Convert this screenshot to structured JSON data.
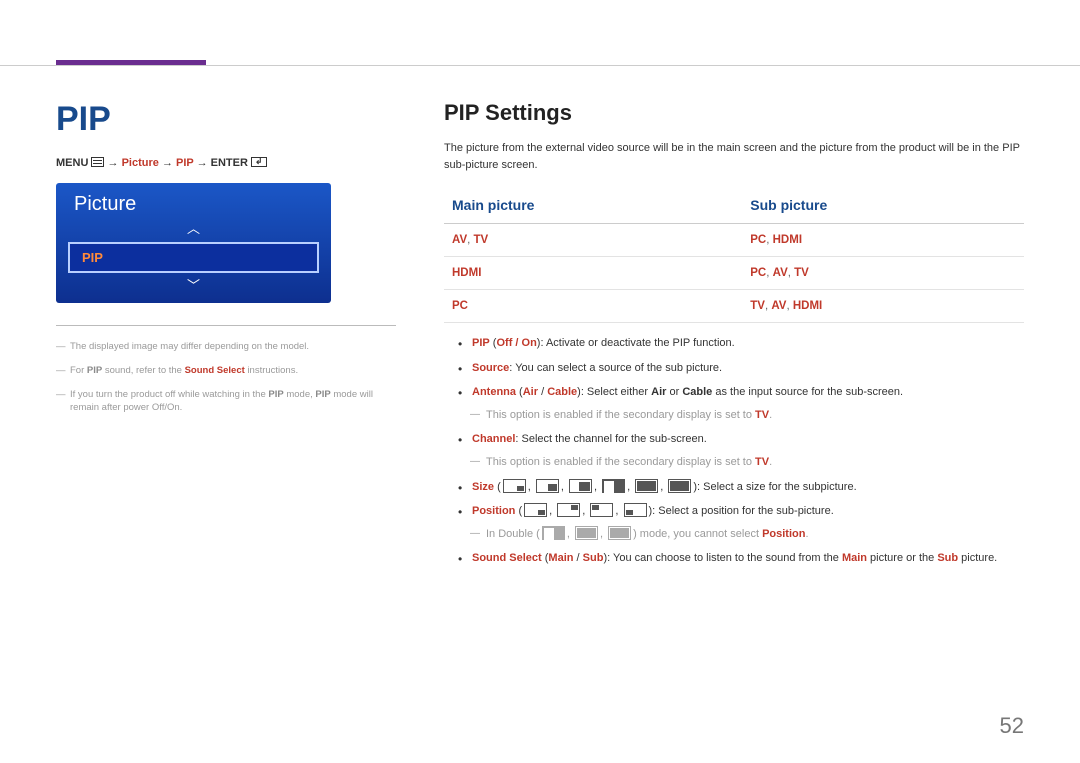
{
  "page_number": "52",
  "left": {
    "title": "PIP",
    "breadcrumb": {
      "menu": "MENU",
      "arrow": " → ",
      "picture": "Picture",
      "pip": "PIP",
      "enter": "ENTER"
    },
    "osd": {
      "title": "Picture",
      "selected": "PIP"
    },
    "notes": {
      "n1": "The displayed image may differ depending on the model.",
      "n2_a": "For ",
      "n2_pip": "PIP",
      "n2_b": " sound, refer to the ",
      "n2_ss": "Sound Select",
      "n2_c": " instructions.",
      "n3_a": "If you turn the product off while watching in the ",
      "n3_pip1": "PIP",
      "n3_b": " mode, ",
      "n3_pip2": "PIP",
      "n3_c": " mode will remain after power Off/On."
    }
  },
  "right": {
    "heading": "PIP Settings",
    "intro": "The picture from the external video source will be in the main screen and the picture from the product will be in the PIP sub-picture screen.",
    "table": {
      "h_main": "Main picture",
      "h_sub": "Sub picture",
      "rows": [
        {
          "main": [
            "AV",
            "TV"
          ],
          "sub": [
            "PC",
            "HDMI"
          ]
        },
        {
          "main": [
            "HDMI"
          ],
          "sub": [
            "PC",
            "AV",
            "TV"
          ]
        },
        {
          "main": [
            "PC"
          ],
          "sub": [
            "TV",
            "AV",
            "HDMI"
          ]
        }
      ]
    },
    "items": {
      "pip": {
        "k": "PIP",
        "opts": "Off / On",
        "tail": "): Activate or deactivate the PIP function."
      },
      "source": {
        "k": "Source",
        "tail": ": You can select a source of the sub picture."
      },
      "antenna": {
        "k": "Antenna",
        "opts_a": "Air",
        "sep": " / ",
        "opts_b": "Cable",
        "mid": "): Select either ",
        "or": " or ",
        "tail2": " as the input source for the sub-screen."
      },
      "antenna_sub_a": "This option is enabled if the secondary display is set to ",
      "antenna_sub_tv": "TV",
      "antenna_sub_dot": ".",
      "channel": {
        "k": "Channel",
        "tail": ": Select the channel for the sub-screen."
      },
      "channel_sub_a": "This option is enabled if the secondary display is set to ",
      "channel_sub_tv": "TV",
      "channel_sub_dot": ".",
      "size": {
        "k": "Size",
        "tail": "): Select a size for the subpicture."
      },
      "position": {
        "k": "Position",
        "tail": "): Select a position for the sub-picture."
      },
      "pos_sub_a": "In Double (",
      "pos_sub_b": ") mode, you cannot select ",
      "pos_sub_k": "Position",
      "pos_sub_dot": ".",
      "soundsel": {
        "k": "Sound Select",
        "opts_a": "Main",
        "sep": " / ",
        "opts_b": "Sub",
        "mid": "): You can choose to listen to the sound from the ",
        "or": " picture or the ",
        "tail2": " picture."
      }
    }
  }
}
